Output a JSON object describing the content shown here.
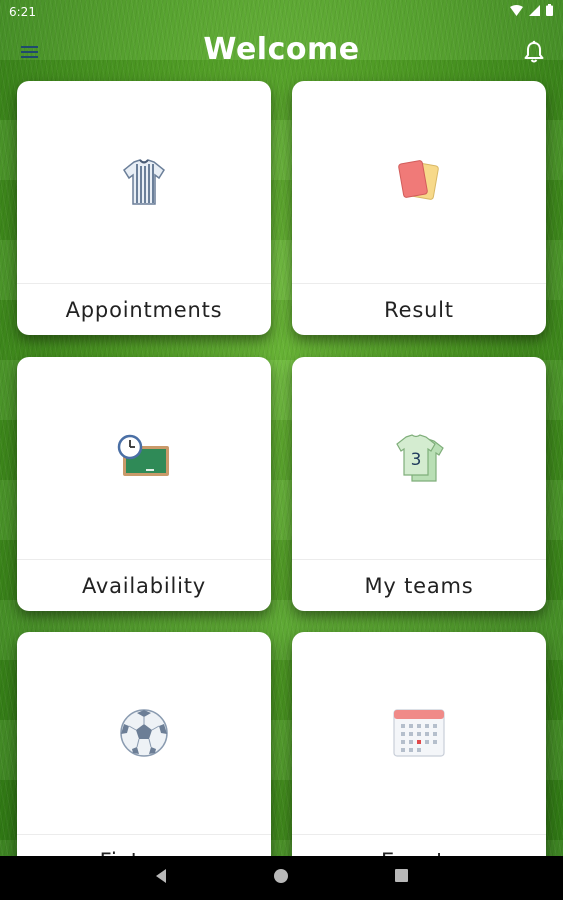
{
  "status_bar": {
    "time": "6:21"
  },
  "header": {
    "title": "Welcome",
    "menu_icon": "hamburger-icon",
    "notifications_icon": "bell-icon"
  },
  "tiles": [
    {
      "label": "Appointments",
      "icon": "referee-shirt-icon"
    },
    {
      "label": "Result",
      "icon": "cards-icon"
    },
    {
      "label": "Availability",
      "icon": "clock-chalkboard-icon"
    },
    {
      "label": "My teams",
      "icon": "team-jersey-icon",
      "jersey_number": "3"
    },
    {
      "label": "Fixtures",
      "icon": "soccer-ball-icon"
    },
    {
      "label": "Events",
      "icon": "calendar-icon"
    }
  ],
  "nav": {
    "back": "back-icon",
    "home": "home-icon",
    "recents": "recents-icon"
  },
  "colors": {
    "red_card": "#f07a78",
    "yellow_card": "#f7d98a",
    "chalkboard": "#2f8a57",
    "header_text": "#ffffff"
  }
}
